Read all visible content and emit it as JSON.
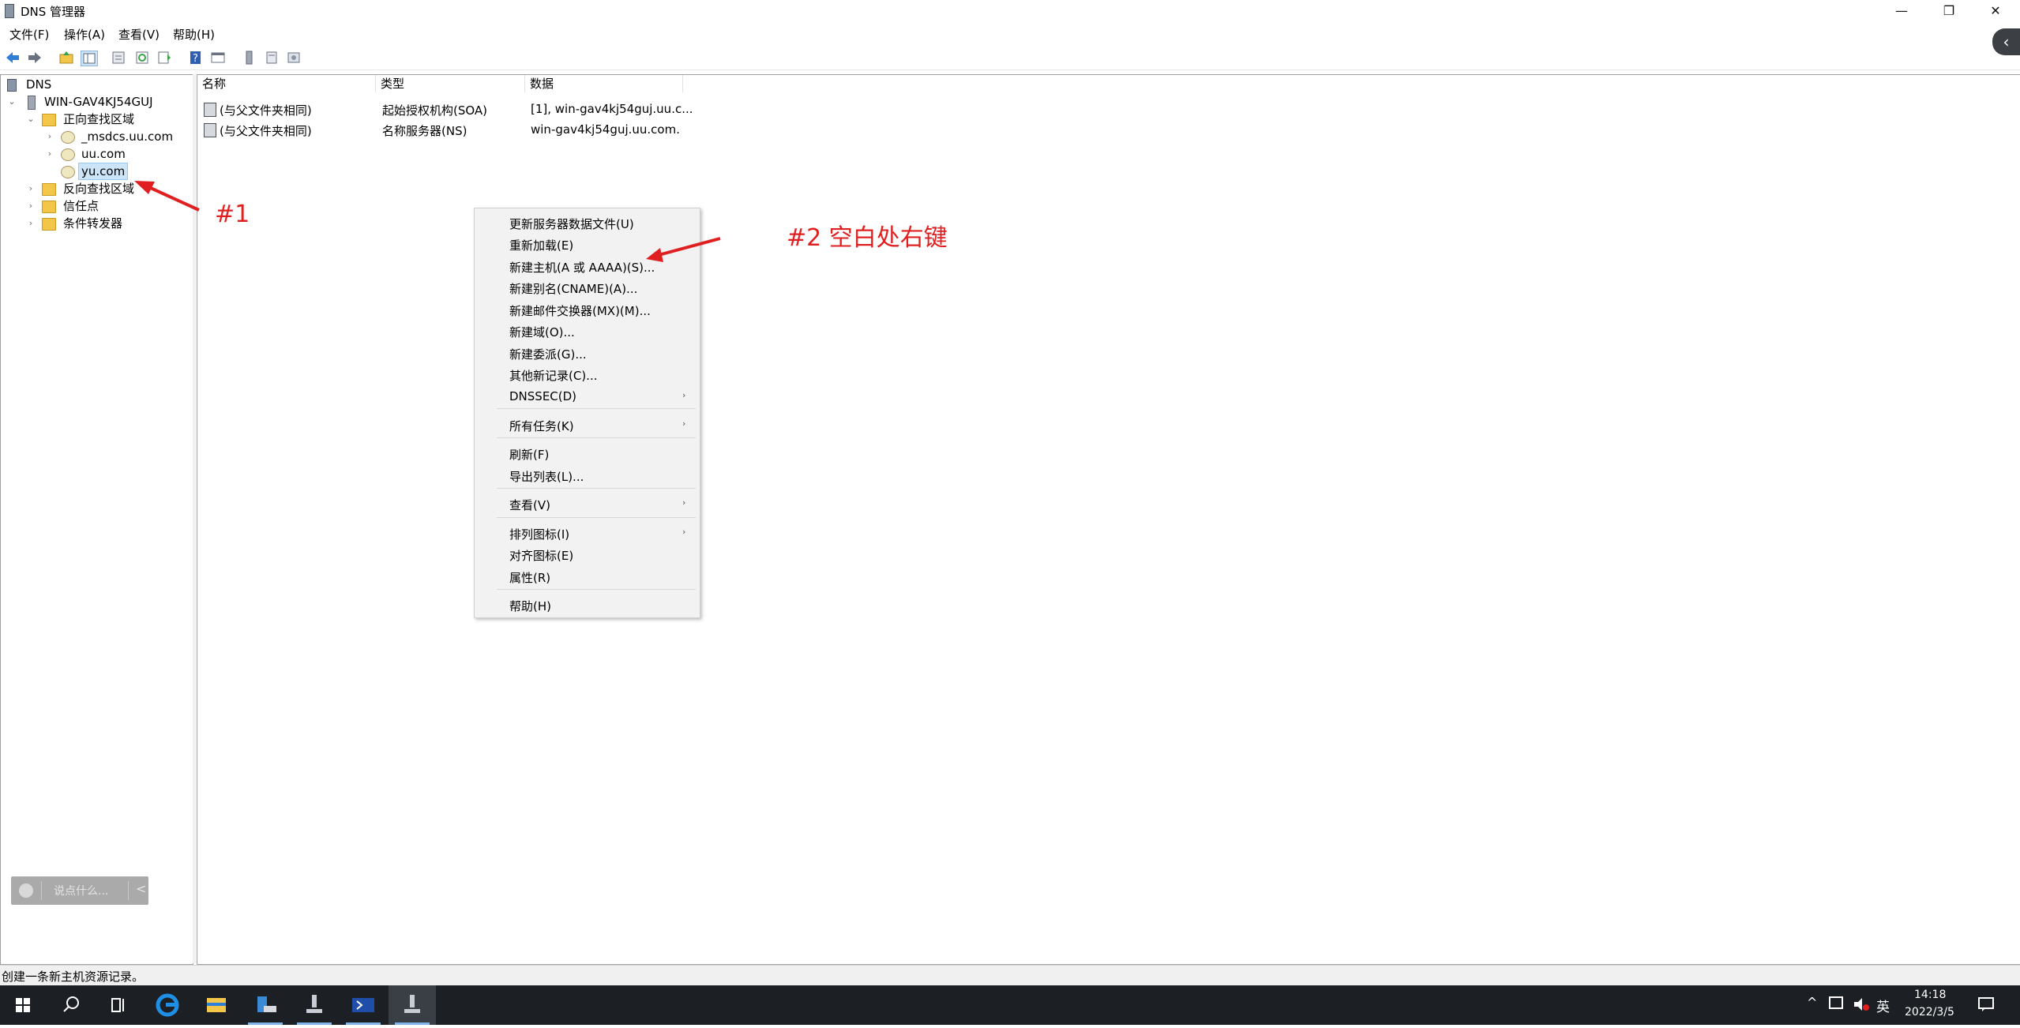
{
  "window": {
    "title": "DNS 管理器",
    "controls": {
      "minimize": "—",
      "restore": "❐",
      "close": "✕"
    }
  },
  "menubar": [
    "文件(F)",
    "操作(A)",
    "查看(V)",
    "帮助(H)"
  ],
  "toolbar_icons": [
    "back-icon",
    "forward-icon",
    "up-folder-icon",
    "show-tree-icon",
    "properties-icon",
    "refresh-icon",
    "export-icon",
    "help-icon",
    "console-icon",
    "server-icon",
    "zone-icon",
    "records-icon"
  ],
  "tree": {
    "root": "DNS",
    "server": "WIN-GAV4KJ54GUJ",
    "forward_zones": "正向查找区域",
    "zones": [
      "_msdcs.uu.com",
      "uu.com",
      "yu.com"
    ],
    "selected_zone": "yu.com",
    "reverse_zones": "反向查找区域",
    "trust_points": "信任点",
    "conditional_forwarders": "条件转发器"
  },
  "list": {
    "columns": [
      "名称",
      "类型",
      "数据"
    ],
    "rows": [
      {
        "name": "(与父文件夹相同)",
        "type": "起始授权机构(SOA)",
        "data": "[1], win-gav4kj54guj.uu.c..."
      },
      {
        "name": "(与父文件夹相同)",
        "type": "名称服务器(NS)",
        "data": "win-gav4kj54guj.uu.com."
      }
    ]
  },
  "context_menu": {
    "items": [
      "更新服务器数据文件(U)",
      "重新加载(E)",
      "新建主机(A 或 AAAA)(S)...",
      "新建别名(CNAME)(A)...",
      "新建邮件交换器(MX)(M)...",
      "新建域(O)...",
      "新建委派(G)...",
      "其他新记录(C)...",
      "DNSSEC(D)",
      "所有任务(K)",
      "刷新(F)",
      "导出列表(L)...",
      "查看(V)",
      "排列图标(I)",
      "对齐图标(E)",
      "属性(R)",
      "帮助(H)"
    ]
  },
  "annotations": {
    "step1": "#1",
    "step2": "#2 空白处右键",
    "color": "#e02020"
  },
  "chat_widget": {
    "placeholder": "说点什么...",
    "collapse": "<"
  },
  "status_bar": "创建一条新主机资源记录。",
  "taskbar": {
    "icons": [
      "start-icon",
      "search-icon",
      "task-view-icon",
      "edge-icon",
      "file-explorer-icon",
      "server-manager-icon",
      "dns-icon",
      "powershell-icon",
      "dns-manager-icon"
    ],
    "tray": {
      "chevron": "^",
      "ime": "英",
      "time": "14:18",
      "date": "2022/3/5"
    }
  }
}
